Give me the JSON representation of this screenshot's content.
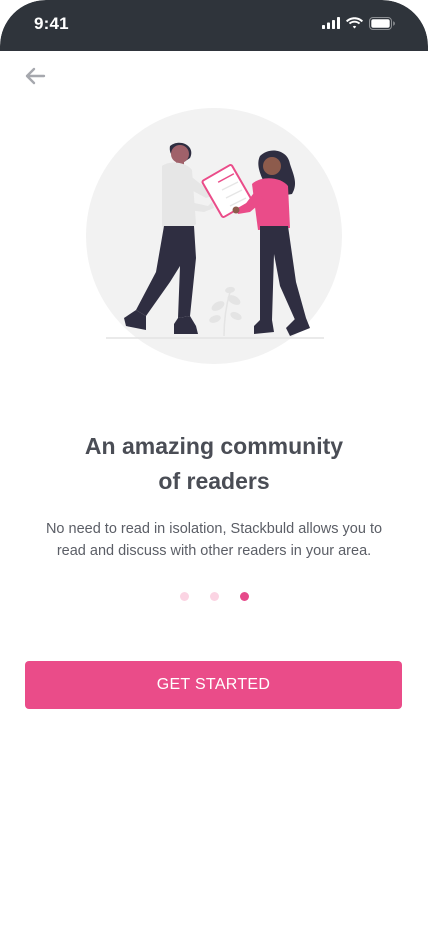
{
  "status_bar": {
    "time": "9:41",
    "icons": [
      "signal-icon",
      "wifi-icon",
      "battery-icon"
    ]
  },
  "nav": {
    "back_icon": "arrow-left-icon"
  },
  "onboarding": {
    "title_line1": "An amazing community",
    "title_line2": "of readers",
    "description": "No need to read in isolation, Stackbuld allows you to read and discuss with other readers in your area.",
    "pagination": {
      "total": 3,
      "active_index": 2
    },
    "cta_label": "GET STARTED"
  },
  "colors": {
    "accent": "#ea4c89",
    "status_bar": "#2f343b",
    "title": "#4a4d55",
    "body_text": "#5b5e66",
    "dot_inactive": "#fbd4e3"
  }
}
